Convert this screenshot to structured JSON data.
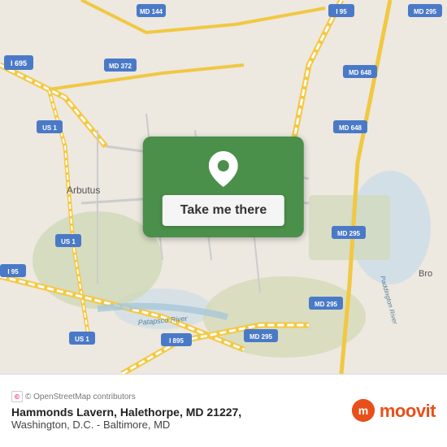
{
  "map": {
    "button_label": "Take me there",
    "attribution": "© OpenStreetMap contributors"
  },
  "info": {
    "place_name": "Hammonds Lavern, Halethorpe, MD 21227,",
    "city_region": "Washington, D.C. - Baltimore, MD",
    "logo_text": "moovit"
  },
  "colors": {
    "green_panel": "#4a8f4a",
    "moovit_orange": "#e8501a",
    "button_bg": "#f5f5f5"
  }
}
